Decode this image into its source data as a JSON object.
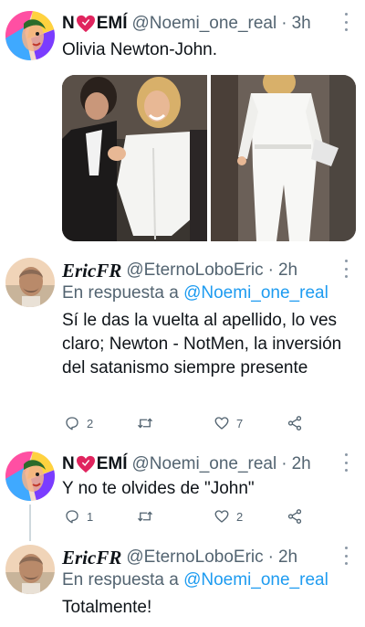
{
  "tweets": [
    {
      "name_prefix": "N",
      "name_suffix": "EMÍ",
      "handle": "@Noemi_one_real",
      "time": "3h",
      "text": "Olivia Newton-John.",
      "media": [
        {
          "icon": "photo-couple-party"
        },
        {
          "icon": "photo-white-jumpsuit"
        }
      ]
    },
    {
      "name": "EricFR",
      "handle": "@EternoLoboEric",
      "time": "2h",
      "reply_label": "En respuesta a",
      "reply_mention": "@Noemi_one_real",
      "text": "Sí le das la vuelta al apellido, lo ves claro; Newton - NotMen, la inversión del satanismo siempre presente",
      "actions": {
        "replies": "2",
        "retweets": "",
        "likes": "7"
      }
    },
    {
      "name_prefix": "N",
      "name_suffix": "EMÍ",
      "handle": "@Noemi_one_real",
      "time": "2h",
      "text": "Y no te olvides de \"John\"",
      "actions": {
        "replies": "1",
        "retweets": "",
        "likes": "2"
      }
    },
    {
      "name": "EricFR",
      "handle": "@EternoLoboEric",
      "time": "2h",
      "reply_label": "En respuesta a",
      "reply_mention": "@Noemi_one_real",
      "text": "Totalmente!"
    }
  ],
  "separator": "·",
  "colors": {
    "accent": "#1d9bf0",
    "muted": "#536471",
    "heart": "#e0245e",
    "line": "#cfd9de"
  }
}
